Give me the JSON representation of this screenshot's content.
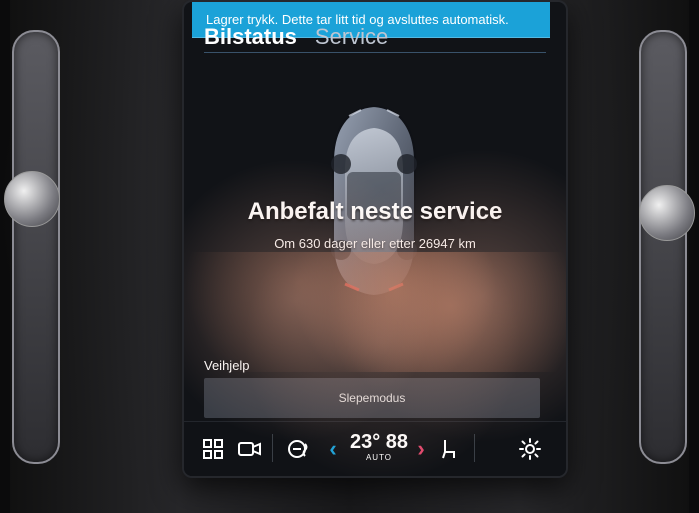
{
  "toast": {
    "text": "Lagrer trykk. Dette tar litt tid og avsluttes automatisk."
  },
  "header": {
    "tabs": [
      {
        "label": "Bilstatus"
      },
      {
        "label": "Service"
      }
    ]
  },
  "service": {
    "title": "Anbefalt neste service",
    "subtitle": "Om 630 dager eller etter 26947 km"
  },
  "roadside": {
    "label": "Veihjelp",
    "action_label": "Slepemodus"
  },
  "bottom_bar": {
    "icons": {
      "home": "grid-icon",
      "camera": "camera-icon",
      "steering_heat": "steering-heat-icon",
      "left": "chevron-left-icon",
      "right": "chevron-right-icon",
      "seat": "seat-icon",
      "settings": "gear-icon"
    },
    "climate": {
      "temp": "23°",
      "fan": "88",
      "mode": "AUTO"
    }
  },
  "colors": {
    "toast_bg": "#1ba2d8",
    "screen_bg": "#111317",
    "accent_cyan": "#1ba2d8",
    "accent_red": "#e0476c"
  }
}
